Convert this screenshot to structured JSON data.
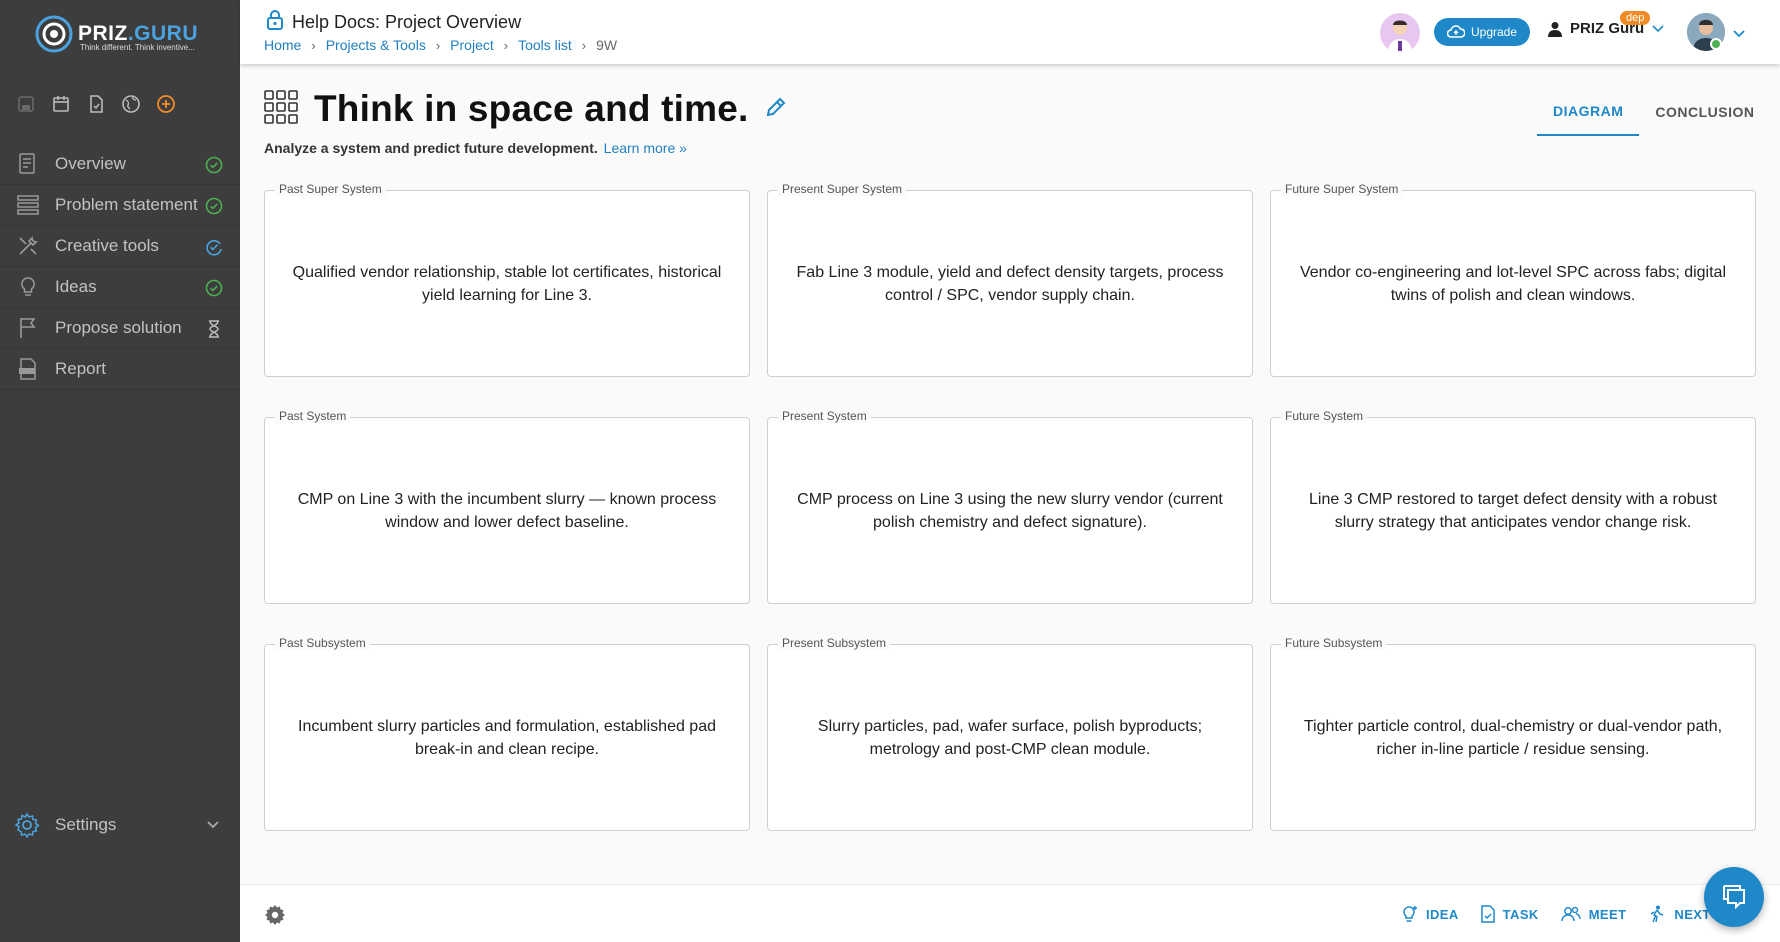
{
  "brand": {
    "name_a": "PRIZ",
    "name_b": ".GURU",
    "tagline": "Think different. Think inventive..."
  },
  "header": {
    "title": "Help Docs: Project Overview",
    "breadcrumb": [
      "Home",
      "Projects & Tools",
      "Project",
      "Tools list"
    ],
    "breadcrumb_current": "9W",
    "upgrade_label": "Upgrade",
    "workspace_name": "PRIZ Guru",
    "badge": "dep"
  },
  "sidebar": {
    "quick_icons": [
      "save-icon",
      "calendar-icon",
      "document-icon",
      "globe-icon",
      "add-circle-icon"
    ],
    "items": [
      {
        "label": "Overview",
        "icon": "overview-icon",
        "status": "done"
      },
      {
        "label": "Problem statement",
        "icon": "list-icon",
        "status": "done"
      },
      {
        "label": "Creative tools",
        "icon": "tools-icon",
        "status": "in-progress"
      },
      {
        "label": "Ideas",
        "icon": "lightbulb-icon",
        "status": "done"
      },
      {
        "label": "Propose solution",
        "icon": "flag-icon",
        "status": "pending"
      },
      {
        "label": "Report",
        "icon": "pdf-icon",
        "status": "none"
      }
    ],
    "settings_label": "Settings"
  },
  "page": {
    "title": "Think in space and time.",
    "subtitle": "Analyze a system and predict future development.",
    "learn_more": "Learn more »",
    "tabs": [
      {
        "label": "DIAGRAM",
        "active": true
      },
      {
        "label": "CONCLUSION",
        "active": false
      }
    ]
  },
  "cells": [
    {
      "label": "Past Super System",
      "text": "Qualified vendor relationship, stable lot certificates, historical yield learning for Line 3."
    },
    {
      "label": "Present Super System",
      "text": "Fab Line 3 module, yield and defect density targets, process control / SPC, vendor supply chain."
    },
    {
      "label": "Future Super System",
      "text": "Vendor co-engineering and lot-level SPC across fabs; digital twins of polish and clean windows."
    },
    {
      "label": "Past System",
      "text": "CMP on Line 3 with the incumbent slurry — known process window and lower defect baseline."
    },
    {
      "label": "Present System",
      "text": "CMP process on Line 3 using the new slurry vendor (current polish chemistry and defect signature)."
    },
    {
      "label": "Future System",
      "text": "Line 3 CMP restored to target defect density with a robust slurry strategy that anticipates vendor change risk."
    },
    {
      "label": "Past Subsystem",
      "text": "Incumbent slurry particles and formulation, established pad break-in and clean recipe."
    },
    {
      "label": "Present Subsystem",
      "text": "Slurry particles, pad, wafer surface, polish byproducts; metrology and post-CMP clean module."
    },
    {
      "label": "Future Subsystem",
      "text": "Tighter particle control, dual-chemistry or dual-vendor path, richer in-line particle / residue sensing."
    }
  ],
  "footer": {
    "buttons": [
      {
        "label": "IDEA"
      },
      {
        "label": "TASK"
      },
      {
        "label": "MEET"
      },
      {
        "label": "NEXT"
      }
    ]
  },
  "colors": {
    "accent": "#1e88c9",
    "sidebar_bg": "#3d3d3d",
    "done": "#4caf50",
    "add": "#f28c28"
  }
}
